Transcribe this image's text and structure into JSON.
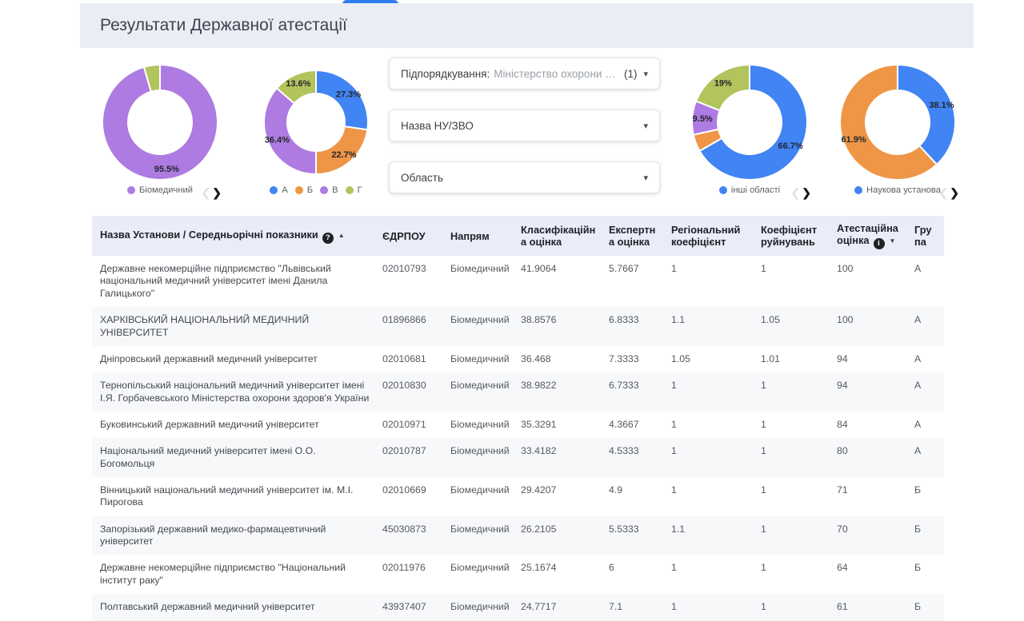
{
  "header": {
    "title": "Результати Державної атестації"
  },
  "colors": {
    "accent_blue": "#4184f3",
    "orange": "#ef9546",
    "purple": "#ad7be1",
    "green": "#b2c45c",
    "band_bg": "#eaedf4",
    "table_header_bg": "#e8edf8",
    "tab_indicator": "#2d7cf0"
  },
  "filters": [
    {
      "label": "Підпорядкування:",
      "value": "Міністерство охорони здо...",
      "count": "(1)",
      "caret": "▾"
    },
    {
      "label": "Назва НУ/ЗВО",
      "value": "",
      "count": "",
      "caret": "▾"
    },
    {
      "label": "Область",
      "value": "",
      "count": "",
      "caret": "▾"
    }
  ],
  "carousel": {
    "prev": "❮",
    "next": "❯"
  },
  "chart_data": [
    {
      "type": "pie",
      "style": "donut",
      "nav": true,
      "legend_position": "bottom",
      "slices": [
        {
          "label": "Біомедичний",
          "value": 95.5,
          "pct_label": "95.5%",
          "color": "#ad7be1"
        },
        {
          "label": "",
          "value": 4.5,
          "pct_label": "",
          "color": "#b2c45c"
        }
      ],
      "legend": [
        {
          "label": "Біомедичний",
          "color": "#ad7be1"
        }
      ]
    },
    {
      "type": "pie",
      "style": "donut",
      "nav": false,
      "legend_position": "bottom",
      "slices": [
        {
          "label": "А",
          "value": 27.3,
          "pct_label": "27.3%",
          "color": "#4184f3"
        },
        {
          "label": "Б",
          "value": 22.7,
          "pct_label": "22.7%",
          "color": "#ef9546"
        },
        {
          "label": "В",
          "value": 36.4,
          "pct_label": "36.4%",
          "color": "#ad7be1"
        },
        {
          "label": "Г",
          "value": 13.6,
          "pct_label": "13.6%",
          "color": "#b2c45c"
        }
      ],
      "legend": [
        {
          "label": "А",
          "color": "#4184f3"
        },
        {
          "label": "Б",
          "color": "#ef9546"
        },
        {
          "label": "В",
          "color": "#ad7be1"
        },
        {
          "label": "Г",
          "color": "#b2c45c"
        }
      ]
    },
    {
      "type": "pie",
      "style": "donut",
      "nav": true,
      "legend_position": "bottom",
      "slices": [
        {
          "label": "інші області",
          "value": 66.7,
          "pct_label": "66.7%",
          "color": "#4184f3"
        },
        {
          "label": "",
          "value": 4.8,
          "pct_label": "",
          "color": "#ef9546"
        },
        {
          "label": "",
          "value": 9.5,
          "pct_label": "9.5%",
          "color": "#ad7be1"
        },
        {
          "label": "",
          "value": 19,
          "pct_label": "19%",
          "color": "#b2c45c"
        }
      ],
      "legend": [
        {
          "label": "інші області",
          "color": "#4184f3"
        }
      ]
    },
    {
      "type": "pie",
      "style": "donut",
      "nav": true,
      "legend_position": "bottom",
      "slices": [
        {
          "label": "Наукова установа",
          "value": 38.1,
          "pct_label": "38.1%",
          "color": "#4184f3"
        },
        {
          "label": "",
          "value": 61.9,
          "pct_label": "61.9%",
          "color": "#ef9546"
        }
      ],
      "legend": [
        {
          "label": "Наукова установа",
          "color": "#4184f3"
        }
      ]
    }
  ],
  "table": {
    "columns": [
      {
        "label": "Назва Установи / Середньорічні показники",
        "icon": "help",
        "icon_glyph": "?",
        "sort": "asc"
      },
      {
        "label": "ЄДРПОУ"
      },
      {
        "label": "Напрям"
      },
      {
        "label": "Класифікаційна оцінка"
      },
      {
        "label": "Експертна оцінка"
      },
      {
        "label": "Регіональний коефіцієнт"
      },
      {
        "label": "Коефіцієнт руйнувань"
      },
      {
        "label": "Атестаційна оцінка",
        "icon": "info",
        "icon_glyph": "i",
        "sort": "desc"
      },
      {
        "label": "Група"
      }
    ],
    "rows": [
      [
        "Державне некомерційне підприємство \"Львівський національний медичний університет імені Данила Галицького\"",
        "02010793",
        "Біомедичний",
        "41.9064",
        "5.7667",
        "1",
        "1",
        "100",
        "А"
      ],
      [
        "ХАРКІВСЬКИЙ НАЦІОНАЛЬНИЙ МЕДИЧНИЙ УНІВЕРСИТЕТ",
        "01896866",
        "Біомедичний",
        "38.8576",
        "6.8333",
        "1.1",
        "1.05",
        "100",
        "А"
      ],
      [
        "Дніпровський державний медичний університет",
        "02010681",
        "Біомедичний",
        "36.468",
        "7.3333",
        "1.05",
        "1.01",
        "94",
        "А"
      ],
      [
        "Тернопільський національний медичний університет імені І.Я. Горбачевського Міністерства охорони здоров'я України",
        "02010830",
        "Біомедичний",
        "38.9822",
        "6.7333",
        "1",
        "1",
        "94",
        "А"
      ],
      [
        "Буковинський державний медичний університет",
        "02010971",
        "Біомедичний",
        "35.3291",
        "4.3667",
        "1",
        "1",
        "84",
        "А"
      ],
      [
        "Національний медичний університет імені О.О. Богомольця",
        "02010787",
        "Біомедичний",
        "33.4182",
        "4.5333",
        "1",
        "1",
        "80",
        "А"
      ],
      [
        "Вінницький національний медичний університет ім. М.І. Пирогова",
        "02010669",
        "Біомедичний",
        "29.4207",
        "4.9",
        "1",
        "1",
        "71",
        "Б"
      ],
      [
        "Запорізький державний медико-фармацевтичний університет",
        "45030873",
        "Біомедичний",
        "26.2105",
        "5.5333",
        "1.1",
        "1",
        "70",
        "Б"
      ],
      [
        "Державне некомерційне підприємство \"Національний інститут раку\"",
        "02011976",
        "Біомедичний",
        "25.1674",
        "6",
        "1",
        "1",
        "64",
        "Б"
      ],
      [
        "Полтавський державний медичний університет",
        "43937407",
        "Біомедичний",
        "24.7717",
        "7.1",
        "1",
        "1",
        "61",
        "Б"
      ]
    ]
  }
}
